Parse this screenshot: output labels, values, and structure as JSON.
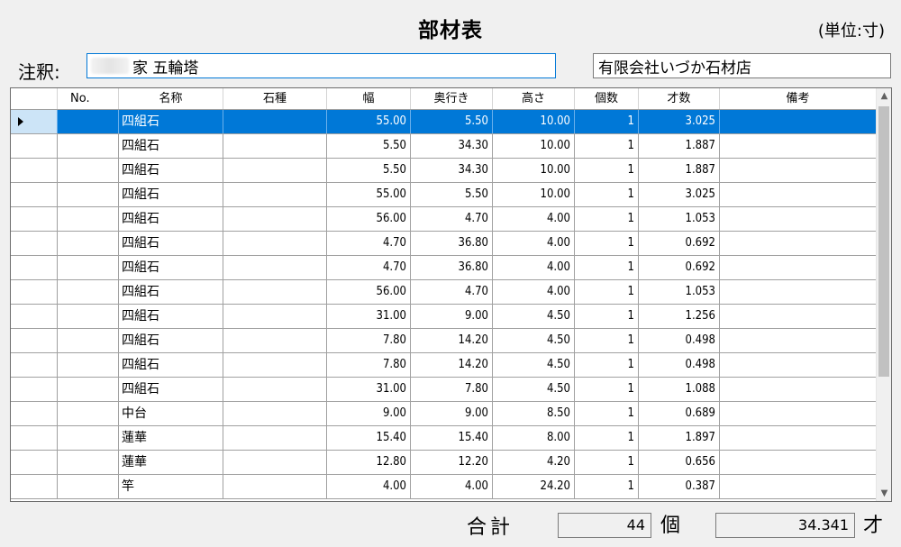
{
  "title": "部材表",
  "unit_note": "(単位:寸)",
  "note": {
    "label": "注釈:",
    "value": "家  五輪塔"
  },
  "company": "有限会社いづか石材店",
  "columns": [
    "No.",
    "名称",
    "石種",
    "幅",
    "奥行き",
    "高さ",
    "個数",
    "才数",
    "備考"
  ],
  "rows": [
    {
      "no": "",
      "name": "四組石",
      "stone": "",
      "width": "55.00",
      "depth": "5.50",
      "height": "10.00",
      "count": "1",
      "sai": "3.025",
      "note": ""
    },
    {
      "no": "",
      "name": "四組石",
      "stone": "",
      "width": "5.50",
      "depth": "34.30",
      "height": "10.00",
      "count": "1",
      "sai": "1.887",
      "note": ""
    },
    {
      "no": "",
      "name": "四組石",
      "stone": "",
      "width": "5.50",
      "depth": "34.30",
      "height": "10.00",
      "count": "1",
      "sai": "1.887",
      "note": ""
    },
    {
      "no": "",
      "name": "四組石",
      "stone": "",
      "width": "55.00",
      "depth": "5.50",
      "height": "10.00",
      "count": "1",
      "sai": "3.025",
      "note": ""
    },
    {
      "no": "",
      "name": "四組石",
      "stone": "",
      "width": "56.00",
      "depth": "4.70",
      "height": "4.00",
      "count": "1",
      "sai": "1.053",
      "note": ""
    },
    {
      "no": "",
      "name": "四組石",
      "stone": "",
      "width": "4.70",
      "depth": "36.80",
      "height": "4.00",
      "count": "1",
      "sai": "0.692",
      "note": ""
    },
    {
      "no": "",
      "name": "四組石",
      "stone": "",
      "width": "4.70",
      "depth": "36.80",
      "height": "4.00",
      "count": "1",
      "sai": "0.692",
      "note": ""
    },
    {
      "no": "",
      "name": "四組石",
      "stone": "",
      "width": "56.00",
      "depth": "4.70",
      "height": "4.00",
      "count": "1",
      "sai": "1.053",
      "note": ""
    },
    {
      "no": "",
      "name": "四組石",
      "stone": "",
      "width": "31.00",
      "depth": "9.00",
      "height": "4.50",
      "count": "1",
      "sai": "1.256",
      "note": ""
    },
    {
      "no": "",
      "name": "四組石",
      "stone": "",
      "width": "7.80",
      "depth": "14.20",
      "height": "4.50",
      "count": "1",
      "sai": "0.498",
      "note": ""
    },
    {
      "no": "",
      "name": "四組石",
      "stone": "",
      "width": "7.80",
      "depth": "14.20",
      "height": "4.50",
      "count": "1",
      "sai": "0.498",
      "note": ""
    },
    {
      "no": "",
      "name": "四組石",
      "stone": "",
      "width": "31.00",
      "depth": "7.80",
      "height": "4.50",
      "count": "1",
      "sai": "1.088",
      "note": ""
    },
    {
      "no": "",
      "name": "中台",
      "stone": "",
      "width": "9.00",
      "depth": "9.00",
      "height": "8.50",
      "count": "1",
      "sai": "0.689",
      "note": ""
    },
    {
      "no": "",
      "name": "蓮華",
      "stone": "",
      "width": "15.40",
      "depth": "15.40",
      "height": "8.00",
      "count": "1",
      "sai": "1.897",
      "note": ""
    },
    {
      "no": "",
      "name": "蓮華",
      "stone": "",
      "width": "12.80",
      "depth": "12.20",
      "height": "4.20",
      "count": "1",
      "sai": "0.656",
      "note": ""
    },
    {
      "no": "",
      "name": "竿",
      "stone": "",
      "width": "4.00",
      "depth": "4.00",
      "height": "24.20",
      "count": "1",
      "sai": "0.387",
      "note": ""
    }
  ],
  "selected_row": 0,
  "totals": {
    "label": "合計",
    "count": "44",
    "count_unit": "個",
    "volume": "34.341",
    "volume_unit": "才"
  },
  "colors": {
    "selection": "#0078d7",
    "input_focus_border": "#0078d7"
  },
  "icons": {
    "row_indicator": "triangle-right-icon",
    "scroll_up": "chevron-up-icon",
    "scroll_down": "chevron-down-icon"
  }
}
